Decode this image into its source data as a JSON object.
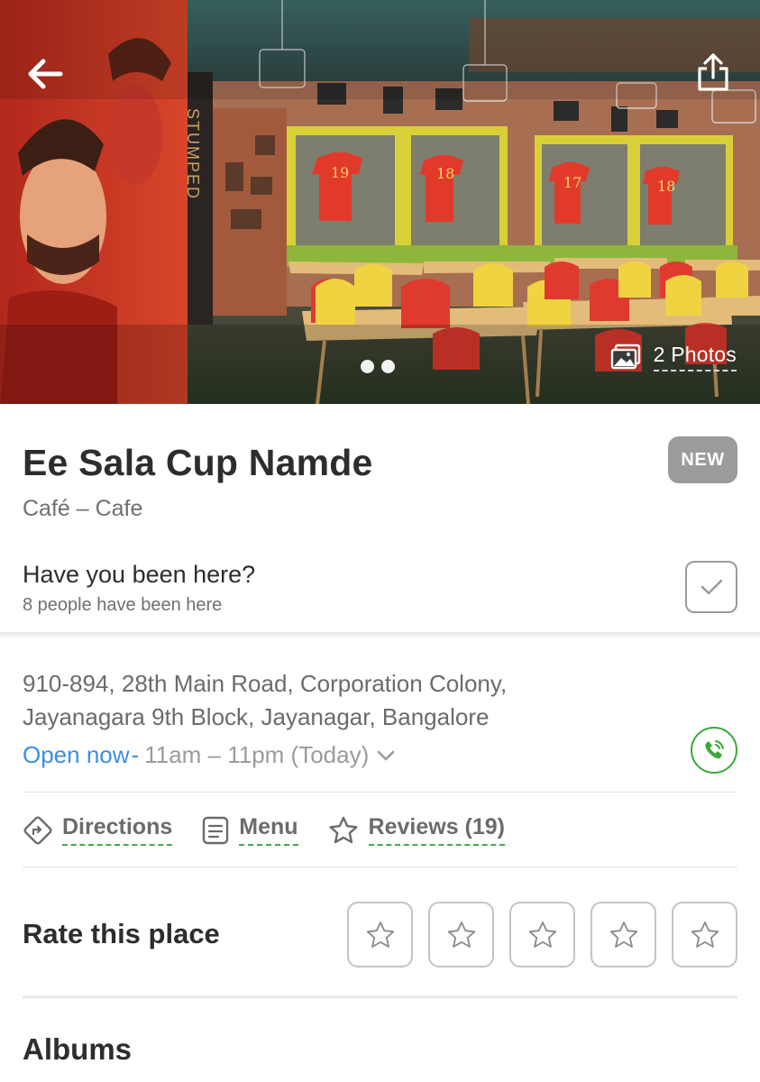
{
  "hero": {
    "photos_label": "2 Photos",
    "wall_sign": "STUMPED",
    "jersey_numbers": [
      "19",
      "18",
      "17",
      "18"
    ]
  },
  "place": {
    "name": "Ee Sala Cup Namde",
    "badge": "NEW",
    "category": "Café – Cafe"
  },
  "visited": {
    "question": "Have you been here?",
    "count_text": "8 people have been here"
  },
  "address": {
    "line1": "910-894, 28th Main Road, Corporation Colony,",
    "line2": "Jayanagara 9th Block, Jayanagar, Bangalore"
  },
  "hours": {
    "status": "Open now",
    "separator": "-",
    "time": "11am – 11pm (Today)"
  },
  "actions": [
    {
      "label": "Directions",
      "icon": "directions-icon"
    },
    {
      "label": "Menu",
      "icon": "menu-icon"
    },
    {
      "label": "Reviews (19)",
      "icon": "star-outline-icon"
    }
  ],
  "rating": {
    "label": "Rate this place",
    "max_stars": 5,
    "current": 0
  },
  "albums": {
    "title": "Albums"
  },
  "colors": {
    "accent_blue": "#3b8ee6",
    "accent_green": "#3aa83a",
    "badge_gray": "#9b9b9b"
  }
}
